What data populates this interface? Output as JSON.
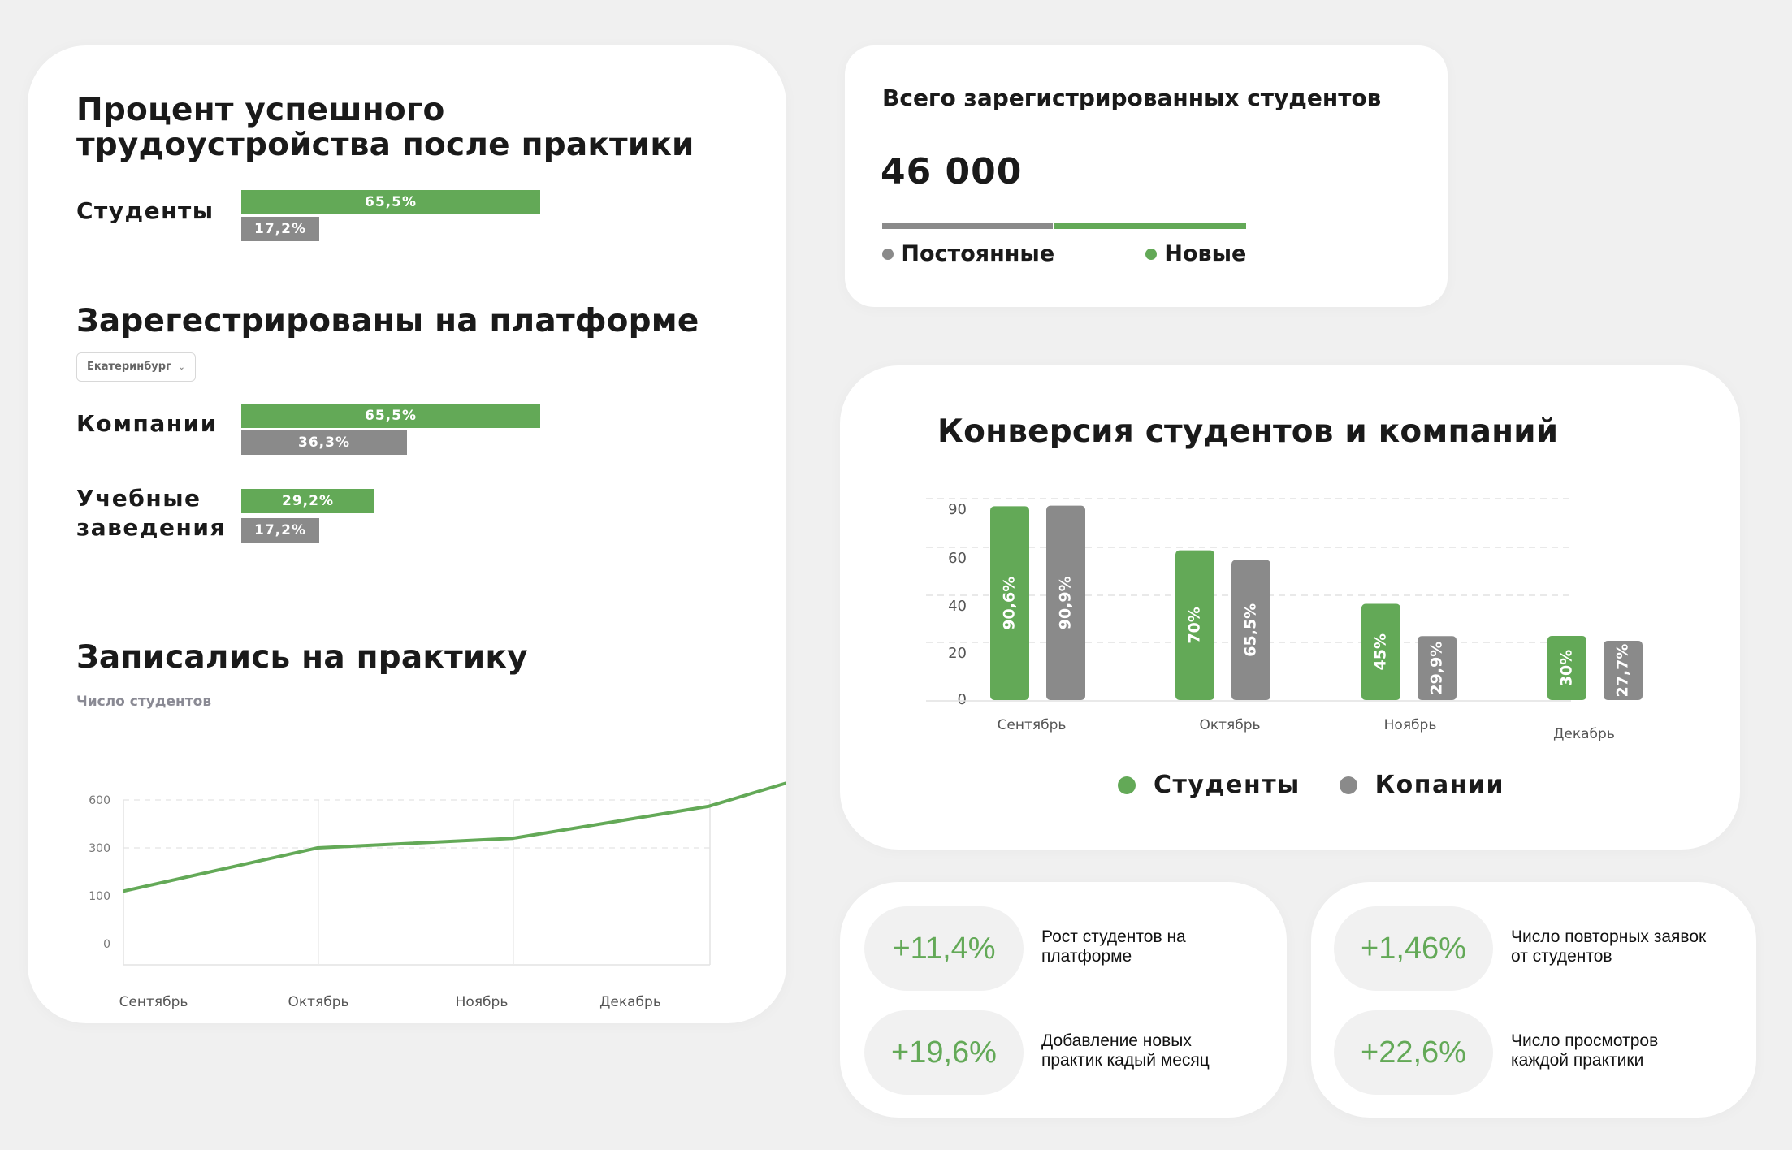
{
  "employment_card": {
    "title_line1": "Процент успешного",
    "title_line2": "трудоустройства после практики",
    "students_label": "Студенты",
    "students_bars": [
      {
        "label": "65,5%",
        "value": 65.5,
        "color": "#63a957"
      },
      {
        "label": "17,2%",
        "value": 17.2,
        "color": "#8a8a8a"
      }
    ],
    "registered_title": "Зарегестрированы на платформе",
    "city_dropdown": "Екатеринбург",
    "companies_label": "Компании",
    "companies_bars": [
      {
        "label": "65,5%",
        "value": 65.5,
        "color": "#63a957"
      },
      {
        "label": "36,3%",
        "value": 36.3,
        "color": "#8a8a8a"
      }
    ],
    "schools_label_line1": "Учебные",
    "schools_label_line2": "заведения",
    "schools_bars": [
      {
        "label": "29,2%",
        "value": 29.2,
        "color": "#63a957"
      },
      {
        "label": "17,2%",
        "value": 17.2,
        "color": "#8a8a8a"
      }
    ],
    "practice_title": "Записались на практику",
    "practice_subtitle": "Число студентов"
  },
  "total_card": {
    "title": "Всего зарегистрированных студентов",
    "value": "46 000",
    "permanent_label": "Постоянные",
    "new_label": "Новые",
    "permanent_share": 0.47,
    "new_share": 0.53
  },
  "conversion_card": {
    "title": "Конверсия студентов и компаний",
    "legend_students": "Студенты",
    "legend_companies": "Копании"
  },
  "stats": [
    {
      "value": "+11,4%",
      "desc_line1": "Рост студентов на",
      "desc_line2": "платформе"
    },
    {
      "value": "+19,6%",
      "desc_line1": "Добавление новых",
      "desc_line2": "практик кадый месяц"
    },
    {
      "value": "+1,46%",
      "desc_line1": "Число повторных заявок",
      "desc_line2": "от студентов"
    },
    {
      "value": "+22,6%",
      "desc_line1": "Число просмотров",
      "desc_line2": "каждой практики"
    }
  ],
  "colors": {
    "green": "#63a957",
    "gray": "#8a8a8a"
  },
  "chart_data": [
    {
      "type": "line",
      "title": "Записались на практику",
      "ylabel": "Число студентов",
      "categories": [
        "Сентябрь",
        "Октябрь",
        "Ноябрь",
        "Декабрь"
      ],
      "y_ticks": [
        "0",
        "100",
        "300",
        "600"
      ],
      "series": [
        {
          "points": [
            [
              0,
              120
            ],
            [
              1,
              300
            ],
            [
              2,
              360
            ],
            [
              3,
              560
            ],
            [
              3.6,
              780
            ]
          ]
        }
      ],
      "grid": true
    },
    {
      "type": "bar",
      "title": "Конверсия студентов и компаний",
      "categories": [
        "Сентябрь",
        "Октябрь",
        "Ноябрь",
        "Декабрь"
      ],
      "y_ticks": [
        "0",
        "20",
        "40",
        "60",
        "90"
      ],
      "series": [
        {
          "name": "Студенты",
          "color": "#63a957",
          "values": [
            90.6,
            70,
            45,
            30
          ],
          "labels": [
            "90,6%",
            "70%",
            "45%",
            "30%"
          ]
        },
        {
          "name": "Копании",
          "color": "#8a8a8a",
          "values": [
            90.9,
            65.5,
            29.9,
            27.7
          ],
          "labels": [
            "90,9%",
            "65,5%",
            "29,9%",
            "27,7%"
          ]
        }
      ],
      "legend": "bottom",
      "grid": true
    }
  ]
}
